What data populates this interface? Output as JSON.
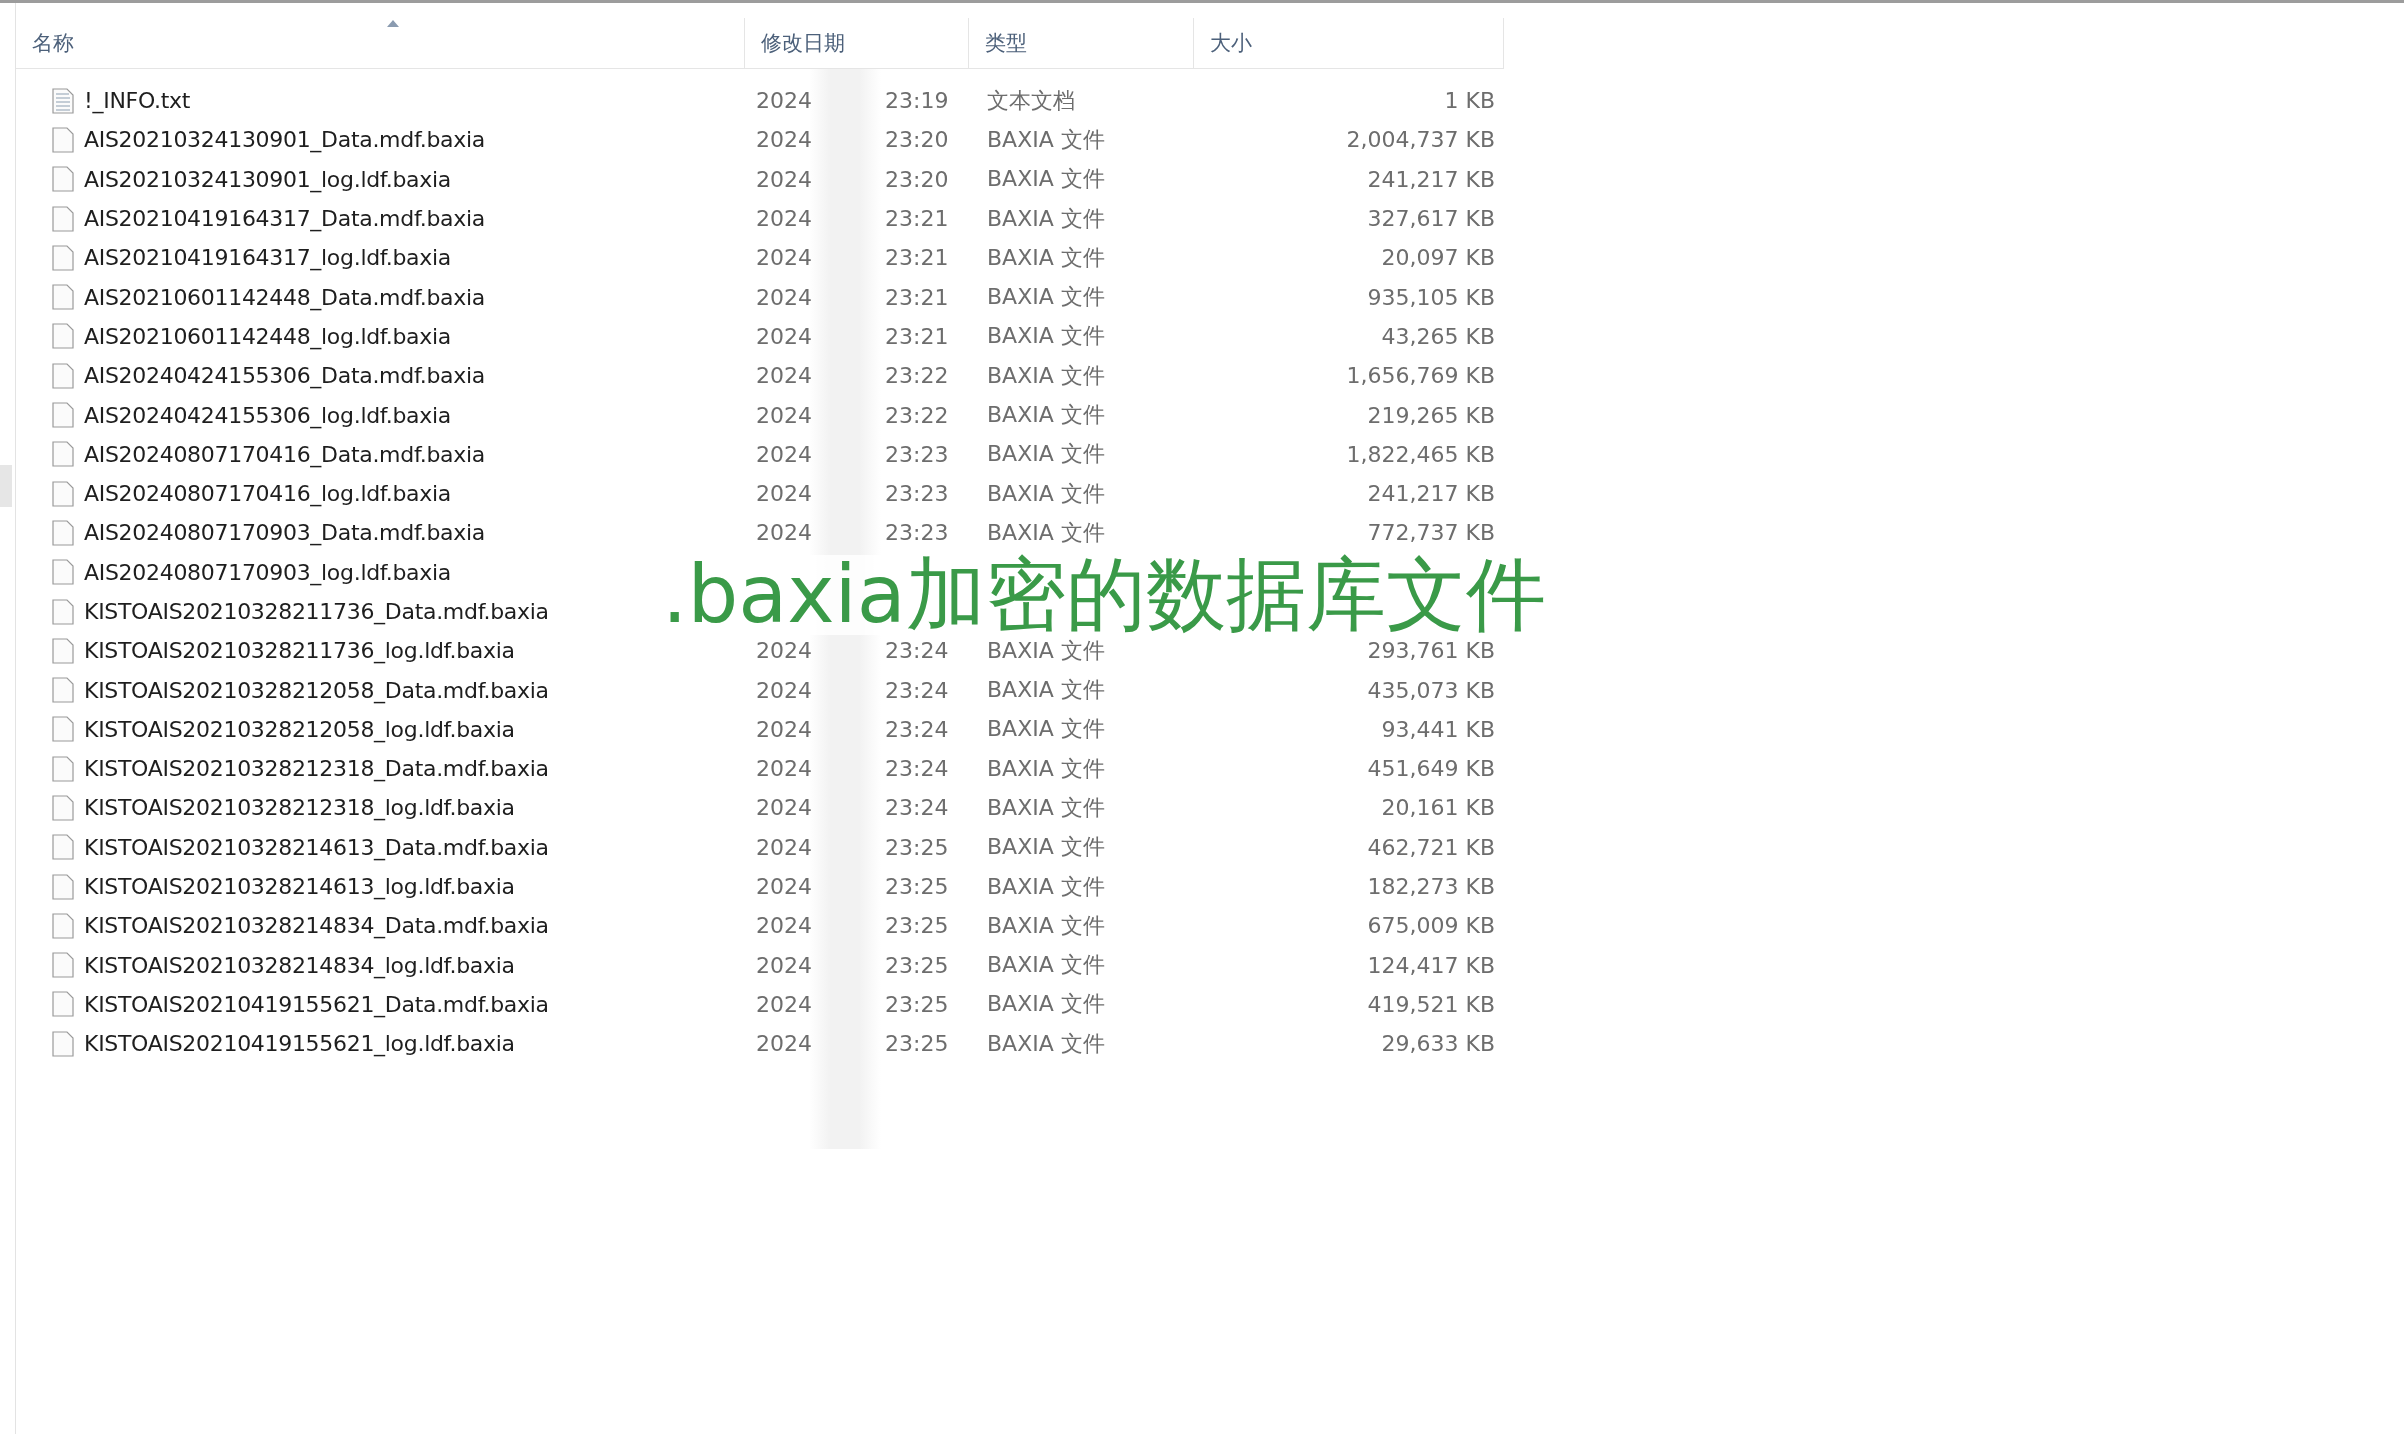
{
  "columns": [
    {
      "label": "名称",
      "sorted": true
    },
    {
      "label": "修改日期",
      "sorted": false
    },
    {
      "label": "类型",
      "sorted": false
    },
    {
      "label": "大小",
      "sorted": false
    }
  ],
  "files": [
    {
      "kind": "text",
      "name": "!_INFO.txt",
      "year": "2024",
      "time": "23:19",
      "type": "文本文档",
      "size": "1 KB"
    },
    {
      "kind": "blank",
      "name": "AIS20210324130901_Data.mdf.baxia",
      "year": "2024",
      "time": "23:20",
      "type": "BAXIA 文件",
      "size": "2,004,737 KB"
    },
    {
      "kind": "blank",
      "name": "AIS20210324130901_log.ldf.baxia",
      "year": "2024",
      "time": "23:20",
      "type": "BAXIA 文件",
      "size": "241,217 KB"
    },
    {
      "kind": "blank",
      "name": "AIS20210419164317_Data.mdf.baxia",
      "year": "2024",
      "time": "23:21",
      "type": "BAXIA 文件",
      "size": "327,617 KB"
    },
    {
      "kind": "blank",
      "name": "AIS20210419164317_log.ldf.baxia",
      "year": "2024",
      "time": "23:21",
      "type": "BAXIA 文件",
      "size": "20,097 KB"
    },
    {
      "kind": "blank",
      "name": "AIS20210601142448_Data.mdf.baxia",
      "year": "2024",
      "time": "23:21",
      "type": "BAXIA 文件",
      "size": "935,105 KB"
    },
    {
      "kind": "blank",
      "name": "AIS20210601142448_log.ldf.baxia",
      "year": "2024",
      "time": "23:21",
      "type": "BAXIA 文件",
      "size": "43,265 KB"
    },
    {
      "kind": "blank",
      "name": "AIS20240424155306_Data.mdf.baxia",
      "year": "2024",
      "time": "23:22",
      "type": "BAXIA 文件",
      "size": "1,656,769 KB"
    },
    {
      "kind": "blank",
      "name": "AIS20240424155306_log.ldf.baxia",
      "year": "2024",
      "time": "23:22",
      "type": "BAXIA 文件",
      "size": "219,265 KB"
    },
    {
      "kind": "blank",
      "name": "AIS20240807170416_Data.mdf.baxia",
      "year": "2024",
      "time": "23:23",
      "type": "BAXIA 文件",
      "size": "1,822,465 KB"
    },
    {
      "kind": "blank",
      "name": "AIS20240807170416_log.ldf.baxia",
      "year": "2024",
      "time": "23:23",
      "type": "BAXIA 文件",
      "size": "241,217 KB"
    },
    {
      "kind": "blank",
      "name": "AIS20240807170903_Data.mdf.baxia",
      "year": "2024",
      "time": "23:23",
      "type": "BAXIA 文件",
      "size": "772,737 KB"
    },
    {
      "kind": "blank",
      "name": "AIS20240807170903_log.ldf.baxia"
    },
    {
      "kind": "blank",
      "name": "KISTOAIS20210328211736_Data.mdf.baxia"
    },
    {
      "kind": "blank",
      "name": "KISTOAIS20210328211736_log.ldf.baxia",
      "year": "2024",
      "time": "23:24",
      "type": "BAXIA 文件",
      "size": "293,761 KB"
    },
    {
      "kind": "blank",
      "name": "KISTOAIS20210328212058_Data.mdf.baxia",
      "year": "2024",
      "time": "23:24",
      "type": "BAXIA 文件",
      "size": "435,073 KB"
    },
    {
      "kind": "blank",
      "name": "KISTOAIS20210328212058_log.ldf.baxia",
      "year": "2024",
      "time": "23:24",
      "type": "BAXIA 文件",
      "size": "93,441 KB"
    },
    {
      "kind": "blank",
      "name": "KISTOAIS20210328212318_Data.mdf.baxia",
      "year": "2024",
      "time": "23:24",
      "type": "BAXIA 文件",
      "size": "451,649 KB"
    },
    {
      "kind": "blank",
      "name": "KISTOAIS20210328212318_log.ldf.baxia",
      "year": "2024",
      "time": "23:24",
      "type": "BAXIA 文件",
      "size": "20,161 KB"
    },
    {
      "kind": "blank",
      "name": "KISTOAIS20210328214613_Data.mdf.baxia",
      "year": "2024",
      "time": "23:25",
      "type": "BAXIA 文件",
      "size": "462,721 KB"
    },
    {
      "kind": "blank",
      "name": "KISTOAIS20210328214613_log.ldf.baxia",
      "year": "2024",
      "time": "23:25",
      "type": "BAXIA 文件",
      "size": "182,273 KB"
    },
    {
      "kind": "blank",
      "name": "KISTOAIS20210328214834_Data.mdf.baxia",
      "year": "2024",
      "time": "23:25",
      "type": "BAXIA 文件",
      "size": "675,009 KB"
    },
    {
      "kind": "blank",
      "name": "KISTOAIS20210328214834_log.ldf.baxia",
      "year": "2024",
      "time": "23:25",
      "type": "BAXIA 文件",
      "size": "124,417 KB"
    },
    {
      "kind": "blank",
      "name": "KISTOAIS20210419155621_Data.mdf.baxia",
      "year": "2024",
      "time": "23:25",
      "type": "BAXIA 文件",
      "size": "419,521 KB"
    },
    {
      "kind": "blank",
      "name": "KISTOAIS20210419155621_log.ldf.baxia",
      "year": "2024",
      "time": "23:25",
      "type": "BAXIA 文件",
      "size": "29,633 KB"
    }
  ],
  "caption": ".baxia加密的数据库文件"
}
